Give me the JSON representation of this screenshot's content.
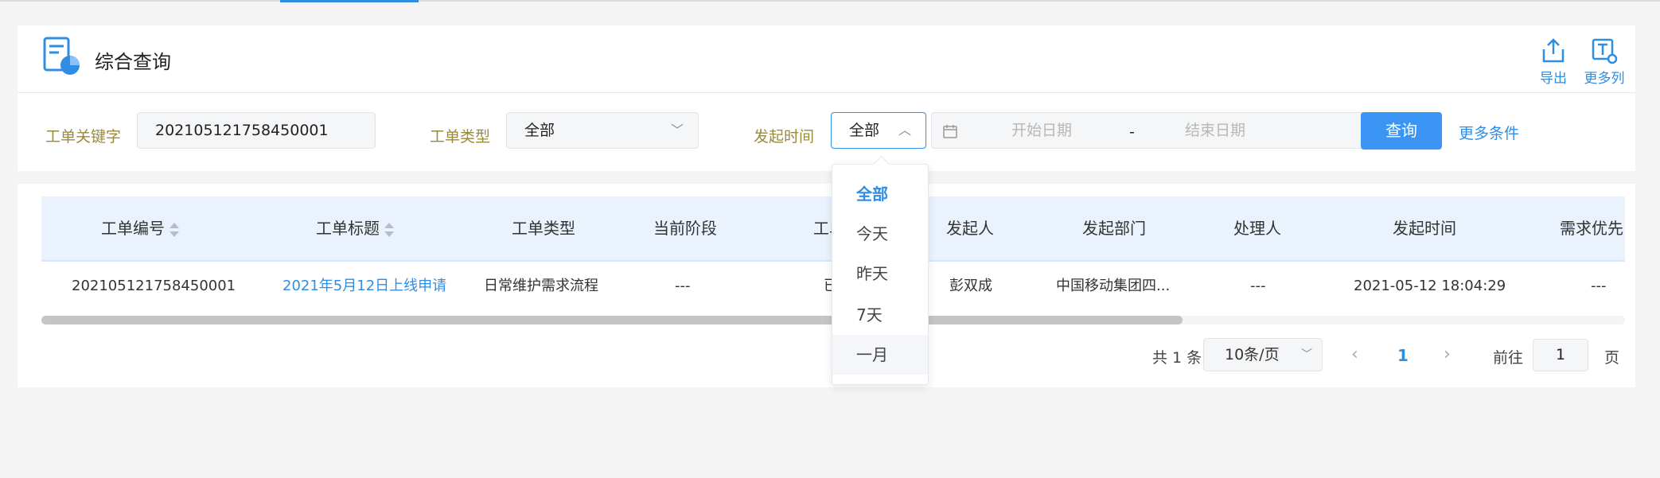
{
  "header": {
    "title": "综合查询",
    "export_label": "导出",
    "more_columns_label": "更多列"
  },
  "filters": {
    "keyword_label": "工单关键字",
    "keyword_value": "202105121758450001",
    "type_label": "工单类型",
    "type_value": "全部",
    "time_label": "发起时间",
    "time_value": "全部",
    "start_placeholder": "开始日期",
    "range_separator": "-",
    "end_placeholder": "结束日期",
    "query_button": "查询",
    "more_conditions": "更多条件"
  },
  "time_dropdown": {
    "options": [
      "全部",
      "今天",
      "昨天",
      "7天",
      "一月"
    ],
    "selected": "全部",
    "hovered": "一月"
  },
  "table": {
    "columns": [
      "工单编号",
      "工单标题",
      "工单类型",
      "当前阶段",
      "工单状态",
      "发起人",
      "发起部门",
      "处理人",
      "发起时间",
      "需求优先"
    ],
    "visible_column_text": {
      "status": "工单",
      "priority": "需求优先"
    },
    "rows": [
      {
        "id": "202105121758450001",
        "title": "2021年5月12日上线申请",
        "type": "日常维护需求流程",
        "stage": "---",
        "status": "已关",
        "initiator": "彭双成",
        "department": "中国移动集团四...",
        "handler": "---",
        "time": "2021-05-12 18:04:29",
        "priority": "---"
      }
    ]
  },
  "pagination": {
    "total": "共 1 条",
    "page_size": "10条/页",
    "current_page": "1",
    "goto_label": "前往",
    "goto_value": "1",
    "goto_suffix": "页"
  },
  "colors": {
    "accent": "#2f8de4",
    "button": "#3a95f5",
    "header_bg": "#eaf3fd",
    "label": "#9a8a3a"
  }
}
